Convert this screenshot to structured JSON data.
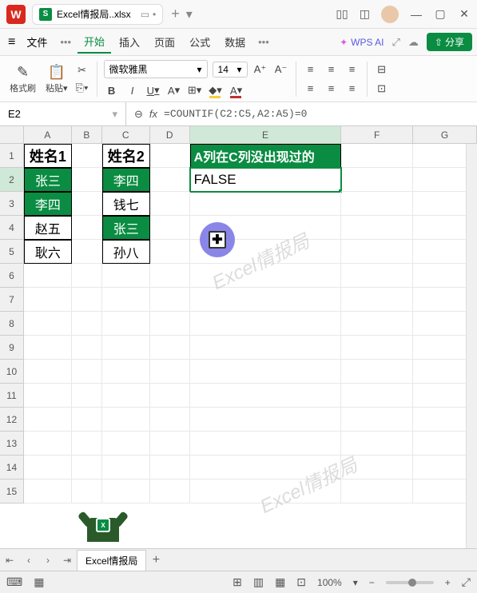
{
  "titlebar": {
    "app_letter": "W",
    "file_icon_letter": "S",
    "filename": "Excel情报局..xlsx"
  },
  "menubar": {
    "file": "文件",
    "tabs": [
      "开始",
      "插入",
      "页面",
      "公式",
      "数据"
    ],
    "ai_label": "WPS AI",
    "share_label": "分享"
  },
  "toolbar": {
    "format_painter": "格式刷",
    "paste": "粘贴",
    "font_name": "微软雅黑",
    "font_size": "14",
    "bold": "B",
    "italic": "I",
    "underline": "U",
    "strike": "A"
  },
  "formula_bar": {
    "cell_ref": "E2",
    "fx": "fx",
    "formula": "=COUNTIF(C2:C5,A2:A5)=0"
  },
  "columns": [
    "A",
    "B",
    "C",
    "D",
    "E",
    "F",
    "G"
  ],
  "chart_data": {
    "type": "table",
    "headers": {
      "A1": "姓名1",
      "C1": "姓名2",
      "E1": "A列在C列没出现过的"
    },
    "rows": [
      {
        "A": "张三",
        "C": "李四",
        "E": "FALSE",
        "A_fill": "green",
        "C_fill": "green"
      },
      {
        "A": "李四",
        "C": "钱七",
        "A_fill": "green"
      },
      {
        "A": "赵五",
        "C": "张三",
        "C_fill": "green"
      },
      {
        "A": "耿六",
        "C": "孙八"
      }
    ]
  },
  "watermark": "Excel情报局",
  "sheet_tab": "Excel情报局",
  "statusbar": {
    "zoom": "100%"
  }
}
